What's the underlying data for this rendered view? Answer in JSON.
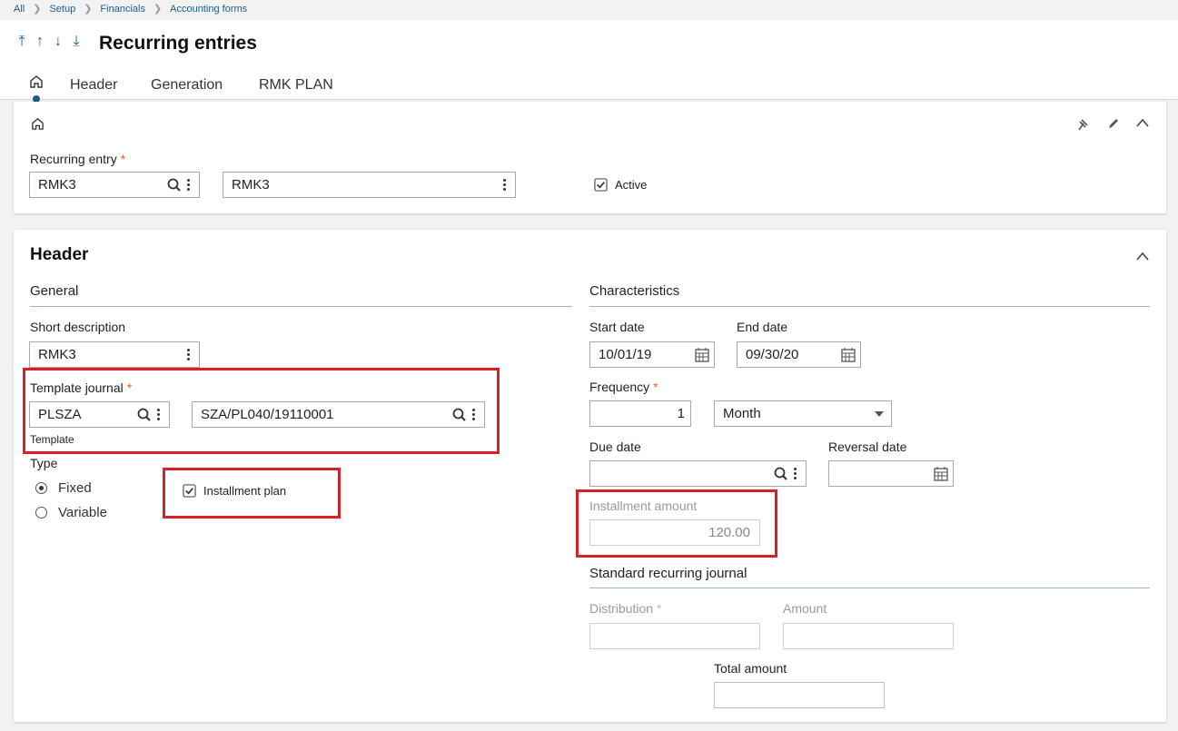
{
  "breadcrumb": [
    "All",
    "Setup",
    "Financials",
    "Accounting forms"
  ],
  "page": {
    "title": "Recurring entries"
  },
  "tabs": [
    "Header",
    "Generation",
    "RMK PLAN"
  ],
  "top_card": {
    "recurring_entry_label": "Recurring entry",
    "required_mark": "*",
    "code_value": "RMK3",
    "description_value": "RMK3",
    "active_label": "Active",
    "active_checked": true
  },
  "header_card": {
    "title": "Header",
    "general": {
      "title": "General",
      "short_description_label": "Short description",
      "short_description_value": "RMK3",
      "template_journal_label": "Template journal",
      "template_code_value": "PLSZA",
      "template_ref_value": "SZA/PL040/19110001",
      "template_caption": "Template",
      "type_label": "Type",
      "type_options": [
        "Fixed",
        "Variable"
      ],
      "type_selected": "Fixed",
      "installment_plan_label": "Installment plan",
      "installment_plan_checked": true
    },
    "characteristics": {
      "title": "Characteristics",
      "start_date_label": "Start date",
      "start_date_value": "10/01/19",
      "end_date_label": "End date",
      "end_date_value": "09/30/20",
      "frequency_label": "Frequency",
      "frequency_value": "1",
      "frequency_unit": "Month",
      "due_date_label": "Due date",
      "due_date_value": "",
      "reversal_date_label": "Reversal date",
      "reversal_date_value": "",
      "installment_amount_label": "Installment amount",
      "installment_amount_value": "120.00"
    },
    "standard": {
      "title": "Standard recurring journal",
      "distribution_label": "Distribution",
      "amount_label": "Amount",
      "total_amount_label": "Total amount"
    }
  },
  "colors": {
    "accent": "#1a5c8c",
    "required": "#e8632b",
    "highlight": "#d9202a"
  }
}
